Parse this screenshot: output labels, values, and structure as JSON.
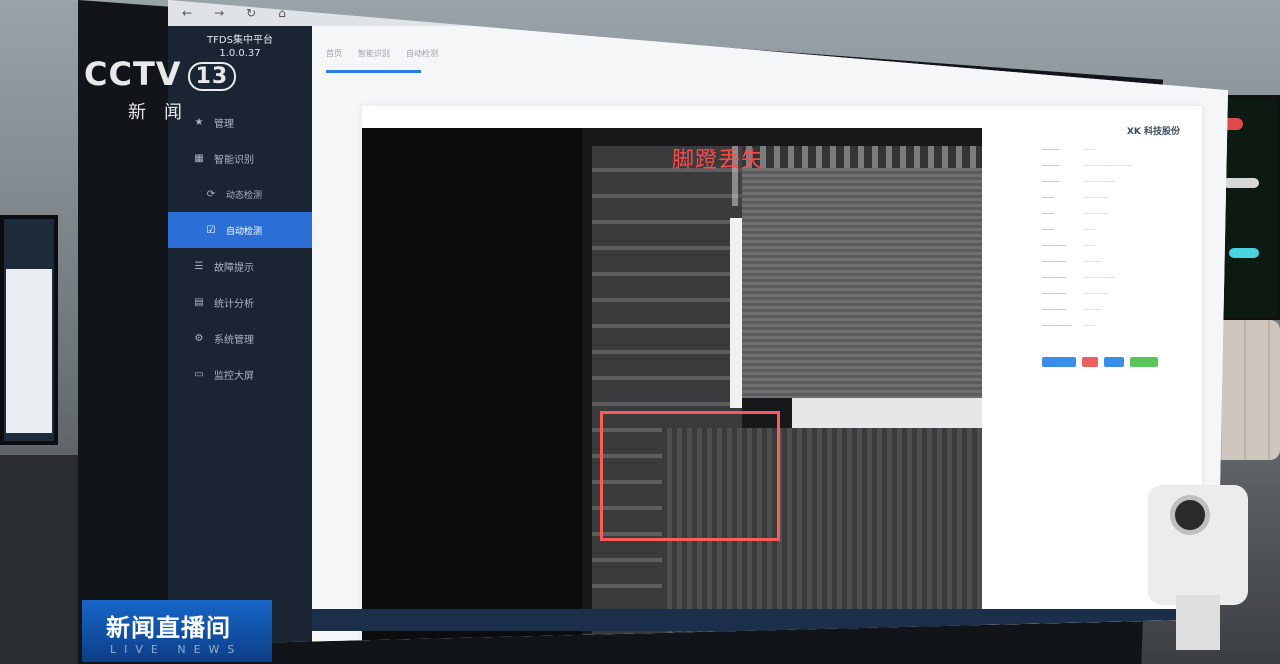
{
  "overlay": {
    "channel_logo": "CCTV",
    "channel_number": "13",
    "channel_sub": "新闻",
    "program_title": "新闻直播间",
    "program_subtitle": "LIVE NEWS"
  },
  "app": {
    "name": "TFDS集中平台",
    "version": "1.0.0.37"
  },
  "sidebar": {
    "items": [
      {
        "label": "管理",
        "icon": "star-icon"
      },
      {
        "label": "智能识别",
        "icon": "grid-icon"
      },
      {
        "label": "动态检测",
        "icon": "refresh-icon"
      },
      {
        "label": "自动检测",
        "icon": "check-icon",
        "active": true
      },
      {
        "label": "故障提示",
        "icon": "list-icon"
      },
      {
        "label": "统计分析",
        "icon": "chart-icon"
      },
      {
        "label": "系统管理",
        "icon": "gear-icon"
      },
      {
        "label": "监控大屏",
        "icon": "screen-icon"
      }
    ]
  },
  "breadcrumb": [
    "首页",
    "智能识别",
    "自动检测"
  ],
  "card": {
    "logo_text": "科技股份",
    "alert_label": "脚蹬丢失"
  },
  "colors": {
    "sidebar_bg": "#1b2433",
    "accent": "#2b7de9",
    "alert": "#ff4a4a"
  }
}
